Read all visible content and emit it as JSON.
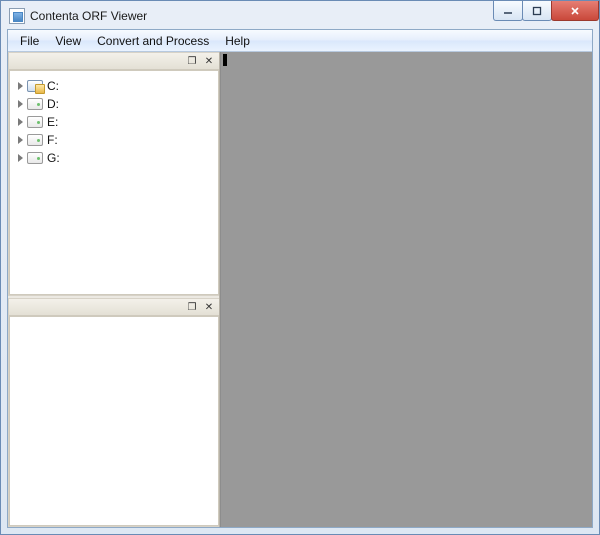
{
  "window": {
    "title": "Contenta ORF Viewer"
  },
  "menu": {
    "file": "File",
    "view": "View",
    "convert": "Convert and Process",
    "help": "Help"
  },
  "dock": {
    "float_glyph": "❐",
    "close_glyph": "✕"
  },
  "drives": [
    {
      "label": "C:",
      "icon": "sys"
    },
    {
      "label": "D:",
      "icon": "hdd"
    },
    {
      "label": "E:",
      "icon": "hdd"
    },
    {
      "label": "F:",
      "icon": "hdd"
    },
    {
      "label": "G:",
      "icon": "hdd"
    }
  ]
}
